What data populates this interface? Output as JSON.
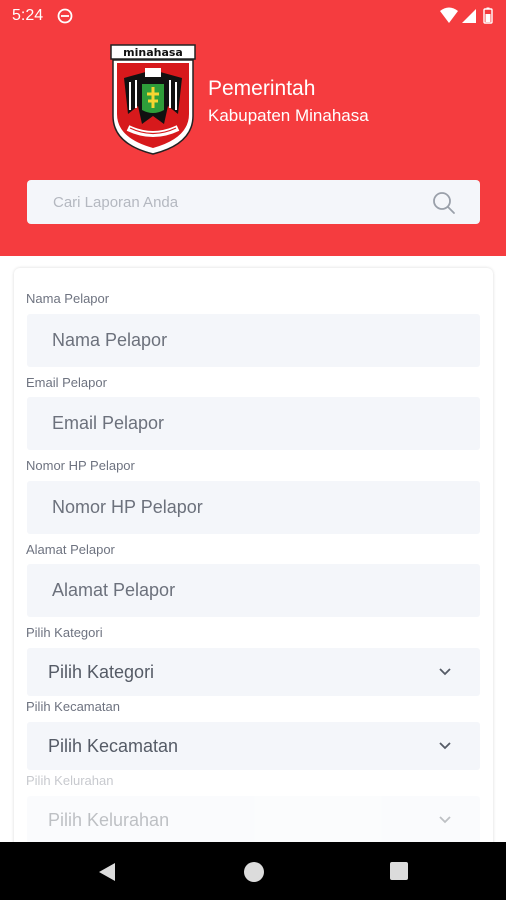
{
  "status_bar": {
    "time": "5:24"
  },
  "header": {
    "logo_text": "minahasa",
    "title": "Pemerintah",
    "subtitle": "Kabupaten Minahasa",
    "search_placeholder": "Cari Laporan Anda"
  },
  "form": {
    "fields": [
      {
        "label": "Nama Pelapor",
        "placeholder": "Nama Pelapor"
      },
      {
        "label": "Email Pelapor",
        "placeholder": "Email Pelapor"
      },
      {
        "label": "Nomor HP Pelapor",
        "placeholder": "Nomor HP Pelapor"
      },
      {
        "label": "Alamat Pelapor",
        "placeholder": "Alamat Pelapor"
      }
    ],
    "selects": [
      {
        "label": "Pilih Kategori",
        "value": "Pilih Kategori"
      },
      {
        "label": "Pilih Kecamatan",
        "value": "Pilih Kecamatan"
      },
      {
        "label": "Pilih Kelurahan",
        "value": "Pilih Kelurahan"
      }
    ]
  },
  "colors": {
    "brand_red": "#f53c3f",
    "field_bg": "#f4f6fa"
  },
  "icons": [
    "dnd-icon",
    "wifi-icon",
    "signal-icon",
    "battery-icon",
    "search-icon",
    "chevron-down-icon",
    "nav-back-icon",
    "nav-home-icon",
    "nav-recent-icon"
  ]
}
